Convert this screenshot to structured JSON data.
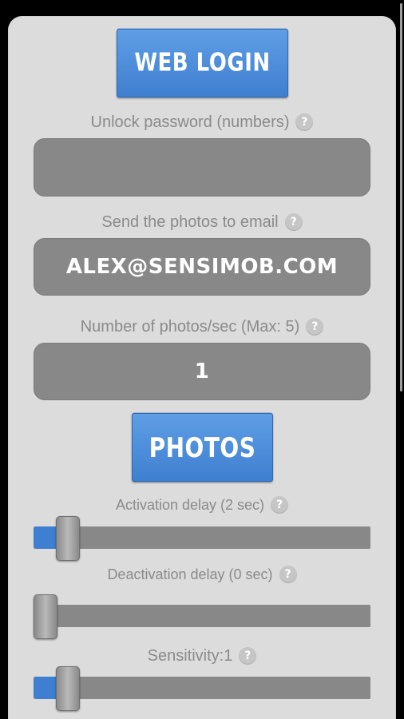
{
  "header": {
    "web_login_label": "WEB LOGIN"
  },
  "unlock": {
    "label": "Unlock password (numbers)",
    "value": ""
  },
  "email": {
    "label": "Send the photos to email",
    "value": "ALEX@SENSIMOB.COM"
  },
  "photos_per_sec": {
    "label": "Number of photos/sec (Max: 5)",
    "value": "1"
  },
  "photos_section": {
    "label": "PHOTOS"
  },
  "sliders": [
    {
      "label": "Activation delay (2 sec)",
      "fill_percent": 7
    },
    {
      "label": "Deactivation delay (0 sec)",
      "fill_percent": 0
    },
    {
      "label": "Sensitivity:1",
      "fill_percent": 7
    }
  ],
  "help_glyph": "?",
  "icons": {
    "help": "question-mark-circle-icon"
  },
  "colors": {
    "accent": "#3e7fd1",
    "field": "#888888",
    "panel": "#dcdcdc",
    "label": "#8a8a8a"
  }
}
